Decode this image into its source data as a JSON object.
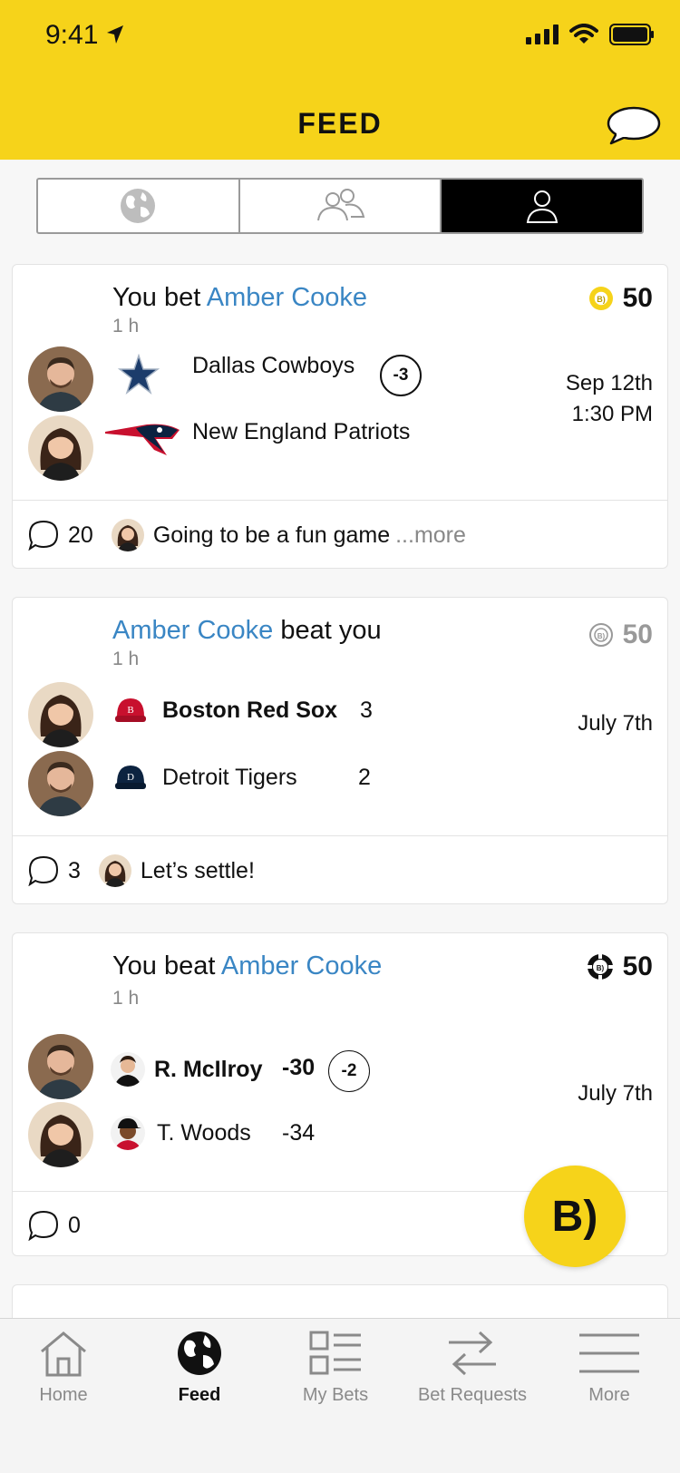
{
  "status_bar": {
    "time": "9:41"
  },
  "header": {
    "title": "FEED"
  },
  "segments": [
    "globe-icon",
    "friends-icon",
    "person-icon"
  ],
  "cards": [
    {
      "headline_prefix": "You bet ",
      "headline_name": "Amber Cooke",
      "headline_suffix": "",
      "time_ago": "1 h",
      "chips": "50",
      "teams": [
        {
          "name": "Dallas Cowboys",
          "spread": "-3"
        },
        {
          "name": "New England Patriots"
        }
      ],
      "date_line1": "Sep 12th",
      "date_line2": "1:30 PM",
      "comment_count": "20",
      "comment_text": "Going to be a fun game",
      "comment_more": "...more"
    },
    {
      "headline_prefix": "",
      "headline_name": "Amber Cooke",
      "headline_suffix": " beat you",
      "time_ago": "1 h",
      "chips": "50",
      "teams": [
        {
          "name": "Boston Red Sox",
          "score": "3"
        },
        {
          "name": "Detroit Tigers",
          "score": "2"
        }
      ],
      "date_line1": "July 7th",
      "comment_count": "3",
      "comment_text": "Let’s settle!"
    },
    {
      "headline_prefix": "You beat ",
      "headline_name": "Amber Cooke",
      "headline_suffix": "",
      "time_ago": "1 h",
      "chips": "50",
      "teams": [
        {
          "name": "R. McIlroy",
          "score": "-30",
          "spread": "-2"
        },
        {
          "name": "T. Woods",
          "score": "-34"
        }
      ],
      "date_line1": "July 7th",
      "comment_count": "0"
    }
  ],
  "fab": {
    "label": "B)"
  },
  "tabbar": [
    {
      "label": "Home"
    },
    {
      "label": "Feed"
    },
    {
      "label": "My Bets"
    },
    {
      "label": "Bet Requests"
    },
    {
      "label": "More"
    }
  ],
  "colors": {
    "brand_yellow": "#f6d31a",
    "link_blue": "#3a86c4",
    "muted": "#888888"
  }
}
